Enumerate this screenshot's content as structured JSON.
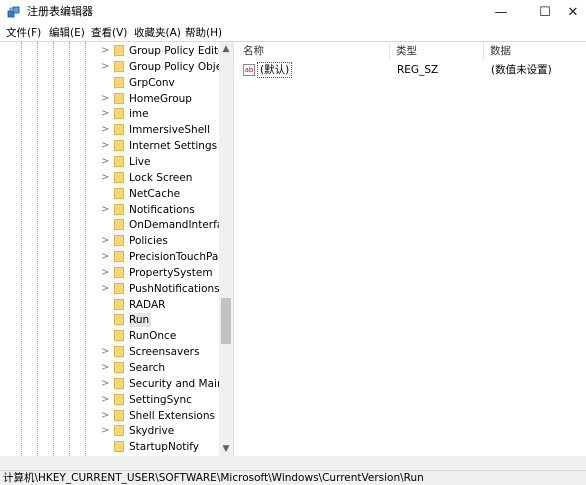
{
  "window": {
    "title": "注册表编辑器",
    "minimize": "—",
    "maximize": "☐",
    "close": "✕"
  },
  "menu": [
    "文件(F)",
    "编辑(E)",
    "查看(V)",
    "收藏夹(A)",
    "帮助(H)"
  ],
  "tree": {
    "items": [
      {
        "label": "Group Policy Editor",
        "arrow": true
      },
      {
        "label": "Group Policy Objec",
        "arrow": true
      },
      {
        "label": "GrpConv",
        "arrow": false
      },
      {
        "label": "HomeGroup",
        "arrow": true
      },
      {
        "label": "ime",
        "arrow": true
      },
      {
        "label": "ImmersiveShell",
        "arrow": true
      },
      {
        "label": "Internet Settings",
        "arrow": true
      },
      {
        "label": "Live",
        "arrow": true
      },
      {
        "label": "Lock Screen",
        "arrow": true
      },
      {
        "label": "NetCache",
        "arrow": false
      },
      {
        "label": "Notifications",
        "arrow": true
      },
      {
        "label": "OnDemandInterface",
        "arrow": false
      },
      {
        "label": "Policies",
        "arrow": true
      },
      {
        "label": "PrecisionTouchPad",
        "arrow": true
      },
      {
        "label": "PropertySystem",
        "arrow": true
      },
      {
        "label": "PushNotifications",
        "arrow": true
      },
      {
        "label": "RADAR",
        "arrow": false
      },
      {
        "label": "Run",
        "arrow": false,
        "selected": true
      },
      {
        "label": "RunOnce",
        "arrow": false
      },
      {
        "label": "Screensavers",
        "arrow": true
      },
      {
        "label": "Search",
        "arrow": true
      },
      {
        "label": "Security and Mainte",
        "arrow": true
      },
      {
        "label": "SettingSync",
        "arrow": true
      },
      {
        "label": "Shell Extensions",
        "arrow": true
      },
      {
        "label": "Skydrive",
        "arrow": true
      },
      {
        "label": "StartupNotify",
        "arrow": false
      }
    ]
  },
  "columns": {
    "name": "名称",
    "type": "类型",
    "data": "数据"
  },
  "values": [
    {
      "icon": "ab",
      "name": "(默认)",
      "type": "REG_SZ",
      "data": "(数值未设置)"
    }
  ],
  "status": "计算机\\HKEY_CURRENT_USER\\SOFTWARE\\Microsoft\\Windows\\CurrentVersion\\Run",
  "scroll": {
    "up": "▲",
    "down": "▼"
  }
}
